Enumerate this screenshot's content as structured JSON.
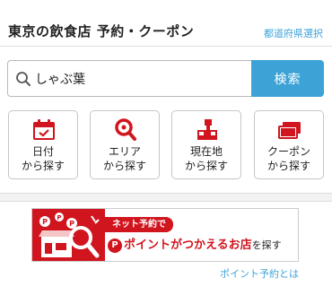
{
  "header": {
    "title": "東京の飲食店 予約・クーポン",
    "pref_link": "都道府県選択"
  },
  "search": {
    "value": "しゃぶ葉",
    "button_label": "検索"
  },
  "categories": [
    {
      "line1": "日付",
      "line2": "から探す",
      "icon": "calendar-icon"
    },
    {
      "line1": "エリア",
      "line2": "から探す",
      "icon": "magnifier-icon"
    },
    {
      "line1": "現在地",
      "line2": "から探す",
      "icon": "map-pin-icon"
    },
    {
      "line1": "クーポン",
      "line2": "から探す",
      "icon": "coupon-icon"
    }
  ],
  "point_banner": {
    "tag": "ネット予約で",
    "p_symbol": "P",
    "main_red": "ポイントがつかえるお店",
    "main_suffix": "を探す"
  },
  "point_link": "ポイント予約とは",
  "colors": {
    "accent_blue": "#3da3d6",
    "link_blue": "#3ea3d8",
    "brand_red": "#d0151e"
  }
}
